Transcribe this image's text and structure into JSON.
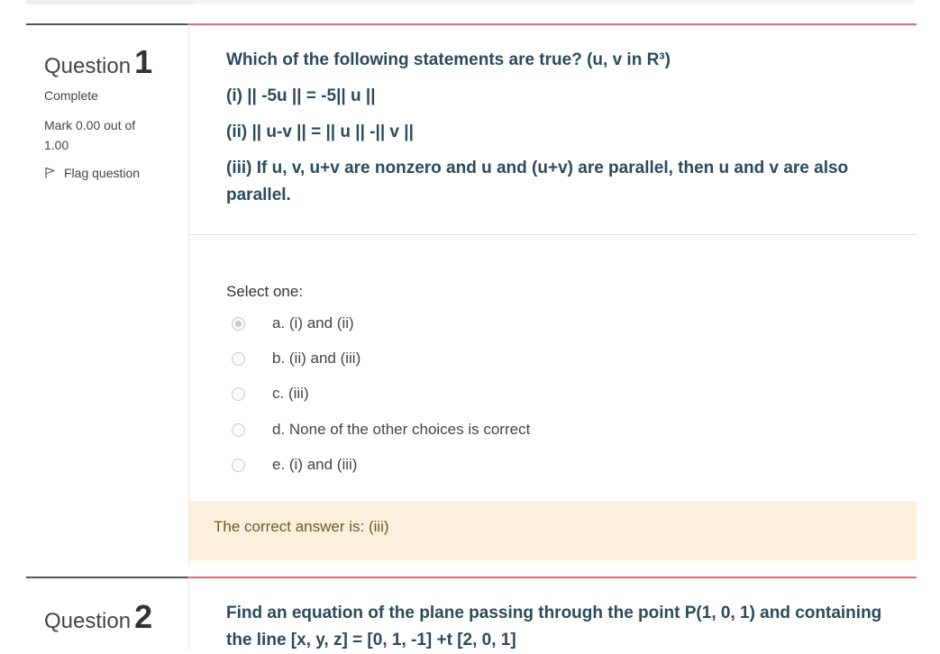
{
  "q1": {
    "label": "Question",
    "number": "1",
    "state": "Complete",
    "grade": "Mark 0.00 out of 1.00",
    "flag": "Flag question",
    "text": {
      "line1": "Which of the following statements are true? (u, v in R³)",
      "line2": "(i) || -5u || = -5|| u ||",
      "line3": "(ii) || u-v || = || u || -|| v ||",
      "line4": "(iii) If u, v, u+v are nonzero and u and (u+v) are parallel, then u and v are also parallel."
    },
    "prompt": "Select one:",
    "options": [
      {
        "label": "a. (i) and (ii)",
        "checked": true
      },
      {
        "label": "b. (ii) and (iii)",
        "checked": false
      },
      {
        "label": "c. (iii)",
        "checked": false
      },
      {
        "label": "d. None of the other choices is correct",
        "checked": false
      },
      {
        "label": "e. (i) and (iii)",
        "checked": false
      }
    ],
    "feedback": "The correct answer is: (iii)"
  },
  "q2": {
    "label": "Question",
    "number": "2",
    "text": "Find an equation of the plane passing through the point P(1, 0, 1) and containing the line [x, y, z] = [0, 1, -1] +t [2, 0, 1]"
  },
  "colors": {
    "question_text": "#2c4a5c",
    "accent_border": "#d86a7a",
    "feedback_bg": "#fcefdc"
  }
}
